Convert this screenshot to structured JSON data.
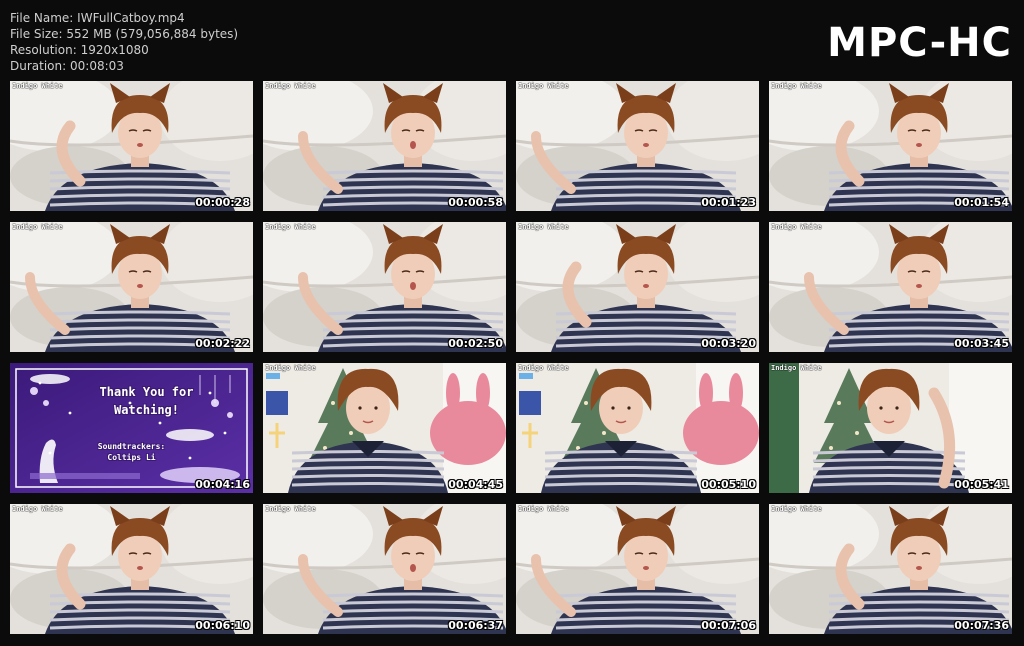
{
  "file_info": {
    "name_label": "File Name:",
    "name_value": "IWFullCatboy.mp4",
    "size_label": "File Size:",
    "size_value": "552 MB (579,056,884 bytes)",
    "resolution_label": "Resolution:",
    "resolution_value": "1920x1080",
    "duration_label": "Duration:",
    "duration_value": "00:08:03"
  },
  "brand": "MPC-HC",
  "watermark": "Indigo White",
  "end_card": {
    "line1": "Thank You for",
    "line2": "Watching!",
    "line3": "Soundtrackers:",
    "line4": "Coltips Li"
  },
  "thumbnails": [
    {
      "timestamp": "00:00:28",
      "scene": "bed"
    },
    {
      "timestamp": "00:00:58",
      "scene": "bed"
    },
    {
      "timestamp": "00:01:23",
      "scene": "bed"
    },
    {
      "timestamp": "00:01:54",
      "scene": "bed"
    },
    {
      "timestamp": "00:02:22",
      "scene": "bed"
    },
    {
      "timestamp": "00:02:50",
      "scene": "bed"
    },
    {
      "timestamp": "00:03:20",
      "scene": "bed"
    },
    {
      "timestamp": "00:03:45",
      "scene": "bed"
    },
    {
      "timestamp": "00:04:16",
      "scene": "endcard"
    },
    {
      "timestamp": "00:04:45",
      "scene": "room"
    },
    {
      "timestamp": "00:05:10",
      "scene": "room"
    },
    {
      "timestamp": "00:05:41",
      "scene": "room"
    },
    {
      "timestamp": "00:06:10",
      "scene": "bed"
    },
    {
      "timestamp": "00:06:37",
      "scene": "bed"
    },
    {
      "timestamp": "00:07:06",
      "scene": "bed"
    },
    {
      "timestamp": "00:07:36",
      "scene": "bed"
    }
  ],
  "colors": {
    "background": "#0b0b0b",
    "header_text": "#cfcfcf",
    "brand_text": "#ffffff",
    "hair": "#8a4a22",
    "shirt_navy": "#2f3450",
    "shirt_stripe": "#c9cad6",
    "bedding": "#e4e1dc",
    "endcard_purple": "#5b2fa6"
  }
}
